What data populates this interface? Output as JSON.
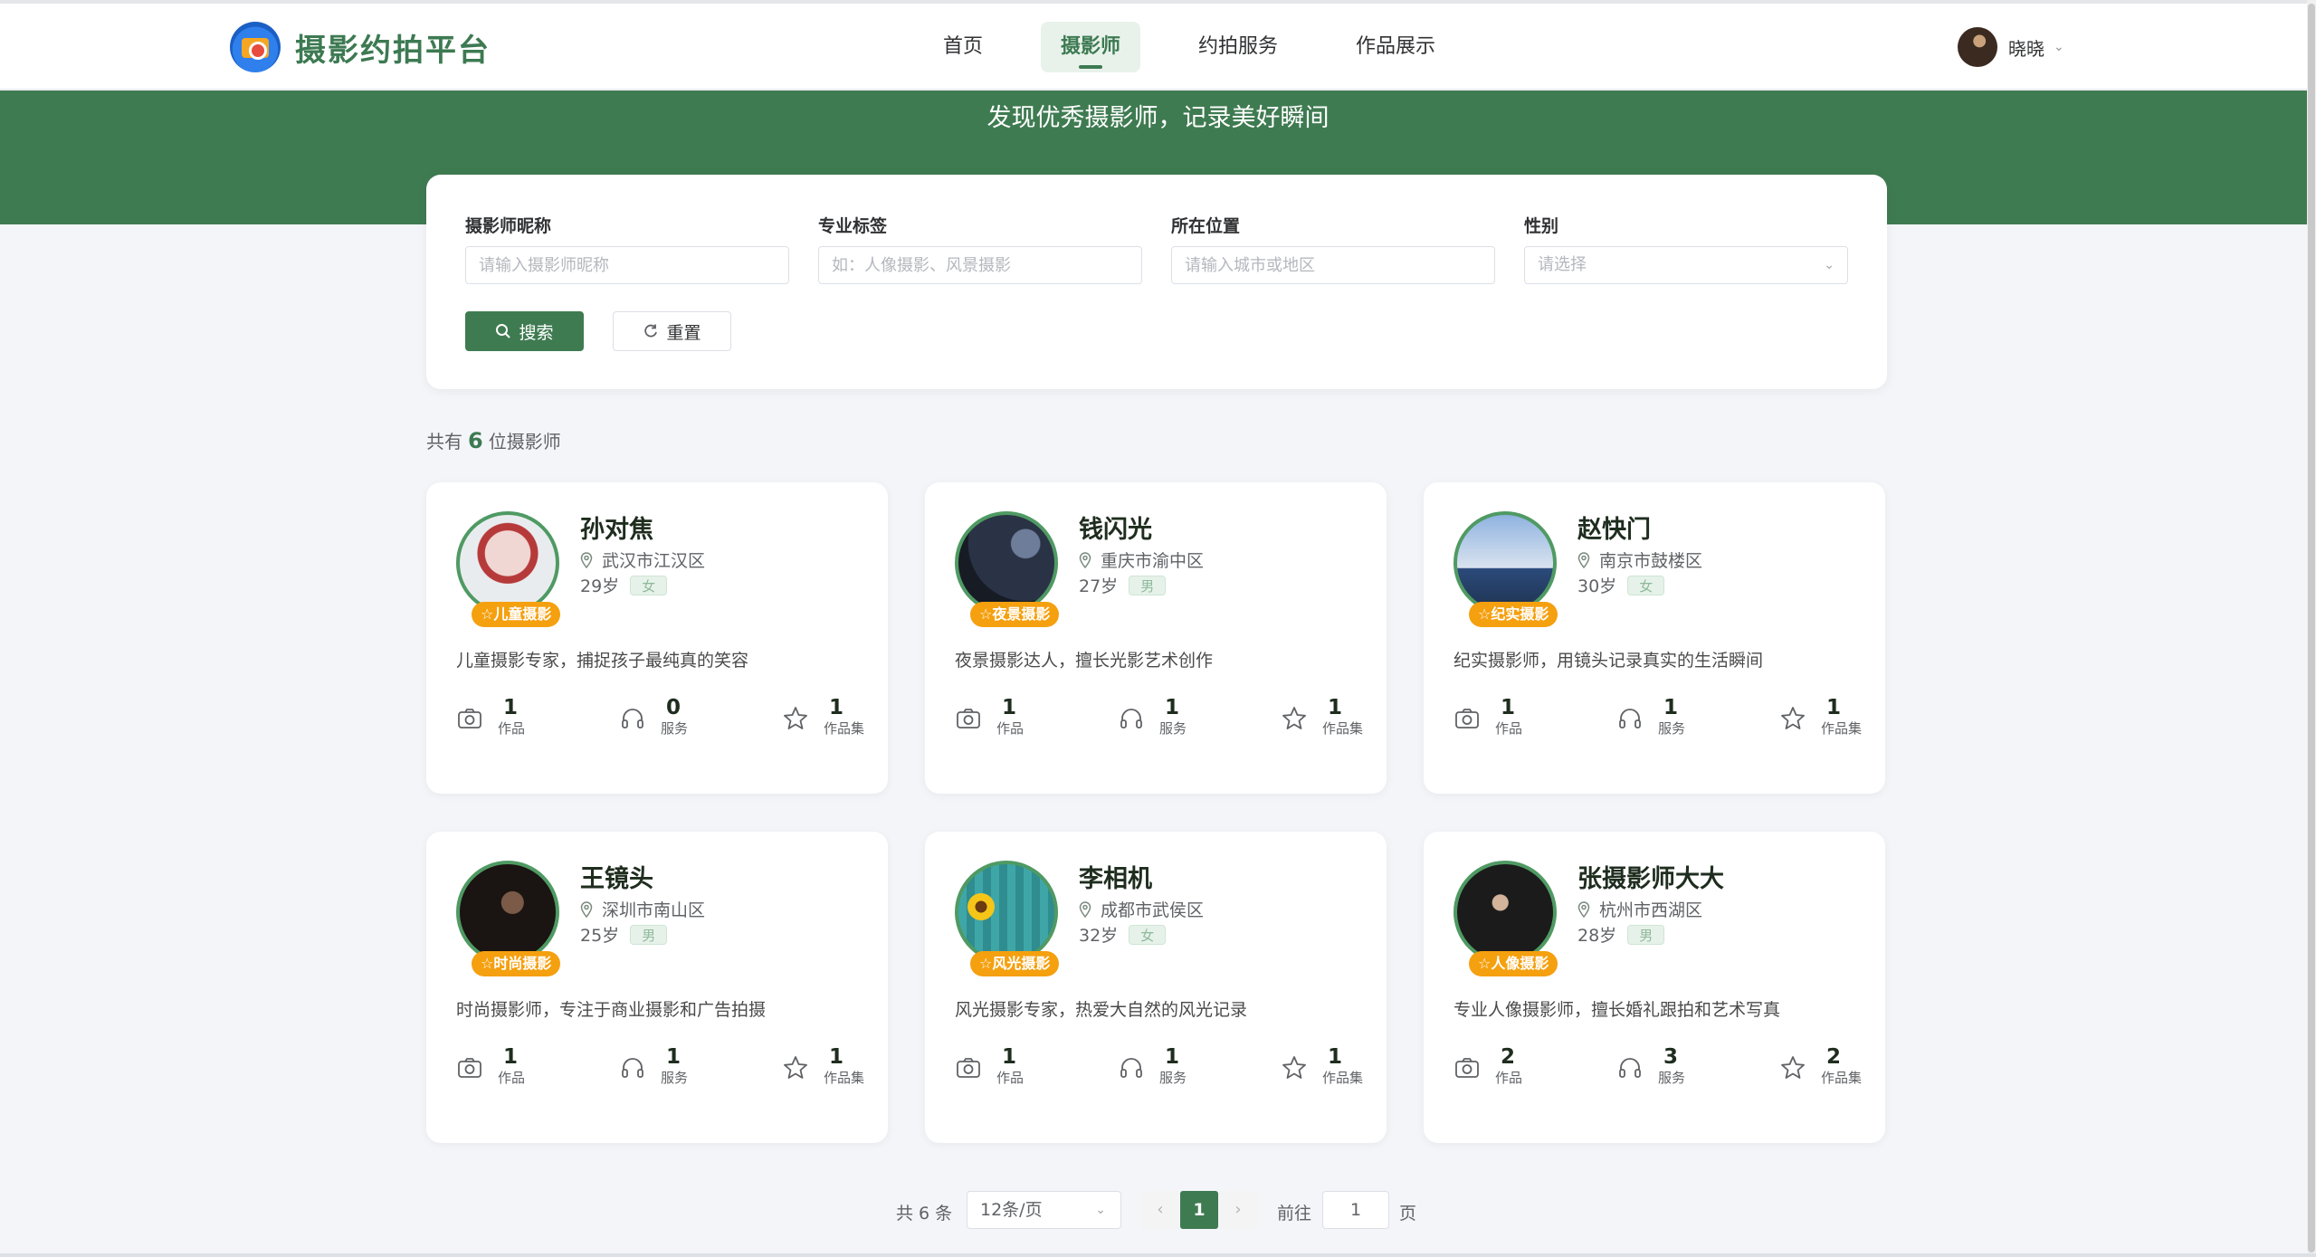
{
  "header": {
    "brand": "摄影约拍平台",
    "nav": [
      {
        "label": "首页",
        "active": false
      },
      {
        "label": "摄影师",
        "active": true
      },
      {
        "label": "约拍服务",
        "active": false
      },
      {
        "label": "作品展示",
        "active": false
      }
    ],
    "user": {
      "name": "晓晓"
    }
  },
  "banner": {
    "slogan": "发现优秀摄影师，记录美好瞬间"
  },
  "search": {
    "nickname": {
      "label": "摄影师昵称",
      "placeholder": "请输入摄影师昵称"
    },
    "tags": {
      "label": "专业标签",
      "placeholder": "如：人像摄影、风景摄影"
    },
    "location": {
      "label": "所在位置",
      "placeholder": "请输入城市或地区"
    },
    "gender": {
      "label": "性别",
      "placeholder": "请选择"
    },
    "search_button": "搜索",
    "reset_button": "重置"
  },
  "summary": {
    "prefix": "共有",
    "count": "6",
    "suffix": "位摄影师"
  },
  "photographers": [
    {
      "name": "孙对焦",
      "location": "武汉市江汉区",
      "age": "29岁",
      "gender": "女",
      "badge": "☆儿童摄影",
      "desc": "儿童摄影专家，捕捉孩子最纯真的笑容",
      "works": "1",
      "services": "0",
      "collections": "1"
    },
    {
      "name": "钱闪光",
      "location": "重庆市渝中区",
      "age": "27岁",
      "gender": "男",
      "badge": "☆夜景摄影",
      "desc": "夜景摄影达人，擅长光影艺术创作",
      "works": "1",
      "services": "1",
      "collections": "1"
    },
    {
      "name": "赵快门",
      "location": "南京市鼓楼区",
      "age": "30岁",
      "gender": "女",
      "badge": "☆纪实摄影",
      "desc": "纪实摄影师，用镜头记录真实的生活瞬间",
      "works": "1",
      "services": "1",
      "collections": "1"
    },
    {
      "name": "王镜头",
      "location": "深圳市南山区",
      "age": "25岁",
      "gender": "男",
      "badge": "☆时尚摄影",
      "desc": "时尚摄影师，专注于商业摄影和广告拍摄",
      "works": "1",
      "services": "1",
      "collections": "1"
    },
    {
      "name": "李相机",
      "location": "成都市武侯区",
      "age": "32岁",
      "gender": "女",
      "badge": "☆风光摄影",
      "desc": "风光摄影专家，热爱大自然的风光记录",
      "works": "1",
      "services": "1",
      "collections": "1"
    },
    {
      "name": "张摄影师大大",
      "location": "杭州市西湖区",
      "age": "28岁",
      "gender": "男",
      "badge": "☆人像摄影",
      "desc": "专业人像摄影师，擅长婚礼跟拍和艺术写真",
      "works": "2",
      "services": "3",
      "collections": "2"
    }
  ],
  "stat_labels": {
    "works": "作品",
    "services": "服务",
    "collections": "作品集"
  },
  "pagination": {
    "total": "共 6 条",
    "page_size": "12条/页",
    "current": "1",
    "goto_prefix": "前往",
    "goto_value": "1",
    "goto_suffix": "页"
  },
  "colors": {
    "primary": "#3f7b51",
    "badge": "#f5a00f"
  }
}
